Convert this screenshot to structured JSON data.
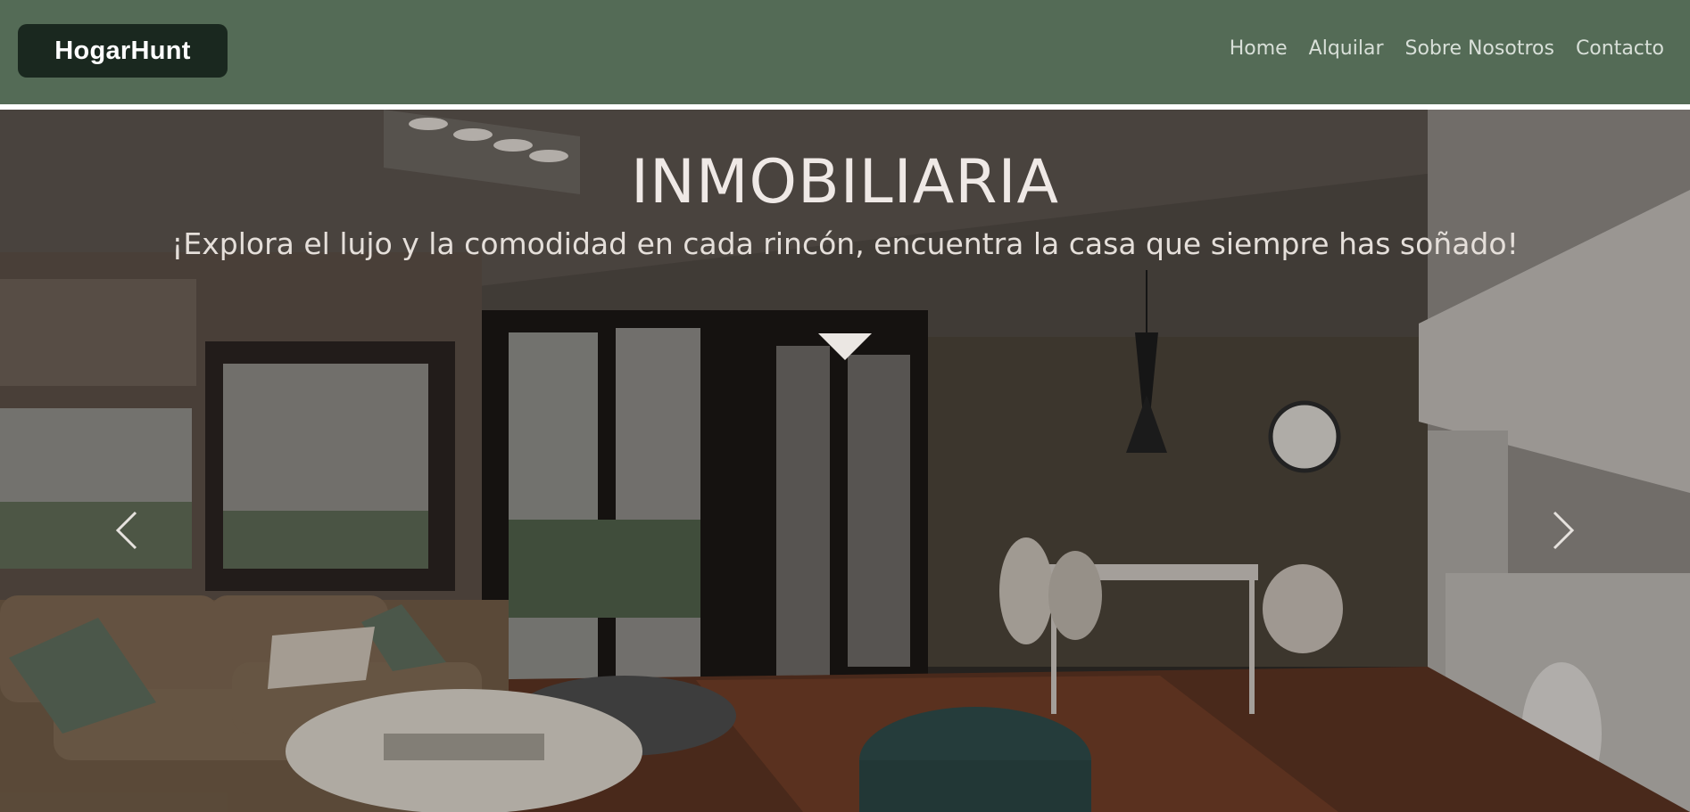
{
  "navbar": {
    "brand": "HogarHunt",
    "links": [
      "Home",
      "Alquilar",
      "Sobre Nosotros",
      "Contacto"
    ]
  },
  "hero": {
    "title": "INMOBILIARIA",
    "subtitle": "¡Explora el lujo y la comodidad en cada rincón, encuentra la casa que siempre has soñado!"
  },
  "carousel": {
    "prev_icon": "chevron-left-icon",
    "next_icon": "chevron-right-icon",
    "indicator_icon": "triangle-down-icon"
  },
  "colors": {
    "navbar_bg": "#546b56",
    "brand_bg": "#1a281f",
    "nav_text": "#d8dfd8",
    "hero_text": "#efe9e6"
  }
}
